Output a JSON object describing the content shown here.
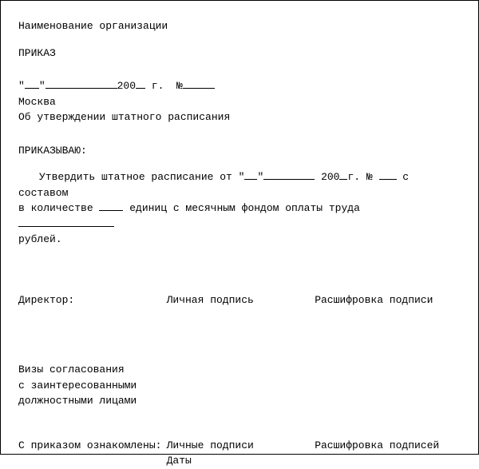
{
  "header": {
    "org_name": "Наименование организации",
    "title": "ПРИКАЗ",
    "date_quote_open": "\"",
    "date_quote_close": "\"",
    "year_prefix": "200",
    "year_suffix": " г.",
    "number_sign": "№",
    "city": "Москва",
    "subject": "Об утверждении штатного расписания"
  },
  "order": {
    "declare": "ПРИКАЗЫВАЮ:",
    "body_1": "Утвердить штатное расписание от \"",
    "body_2": "\"",
    "body_3": " 200",
    "body_4": "г. № ",
    "body_5": " с составом",
    "body_6": "в количестве ",
    "body_7": " единиц с месячным фондом оплаты труда ",
    "body_8": "рублей."
  },
  "signatures": {
    "director": "Директор:",
    "personal_sign": "Личная подпись",
    "sign_decode": "Расшифровка подписи"
  },
  "approval": {
    "line1": "Визы согласования",
    "line2": "с заинтересованными",
    "line3": "должностными лицами"
  },
  "ack": {
    "label": "С приказом ознакомлены:",
    "signs": "Личные подписи",
    "decode": "Расшифровка подписей",
    "dates": "Даты"
  }
}
